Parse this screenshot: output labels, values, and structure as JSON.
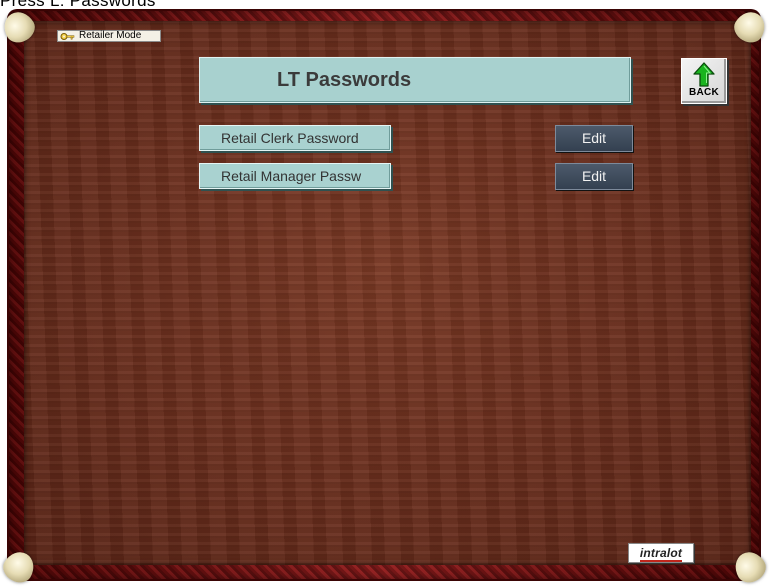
{
  "window": {
    "caption": "Press L: Passwords"
  },
  "header": {
    "mode_label": "Retailer Mode",
    "title": "LT Passwords",
    "back_label": "BACK"
  },
  "passwords": {
    "items": [
      {
        "label": "Retail Clerk Password",
        "action": "Edit"
      },
      {
        "label": "Retail Manager Passw",
        "action": "Edit"
      }
    ]
  },
  "footer": {
    "brand": "intralot"
  },
  "icons": {
    "mode": "key-icon",
    "back": "green-up-arrow-icon"
  },
  "colors": {
    "frame": "#8f1616",
    "wood": "#6a2e1d",
    "title_bg": "#a8d1cf",
    "edit_bg": "#3f4b5b",
    "back_arrow": "#19b41e"
  }
}
